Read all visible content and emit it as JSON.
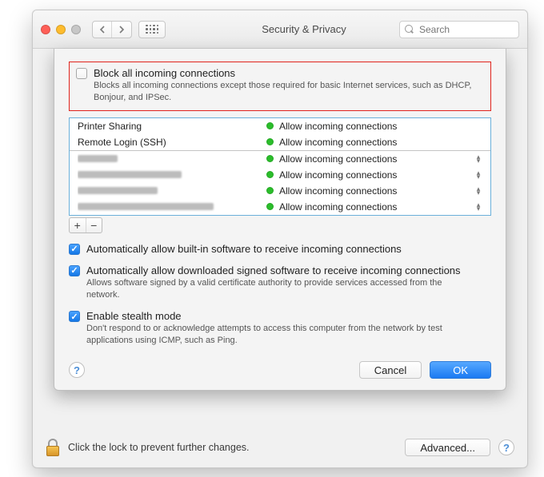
{
  "window": {
    "title": "Security & Privacy",
    "search_placeholder": "Search"
  },
  "sheet": {
    "block_all": {
      "checked": false,
      "label": "Block all incoming connections",
      "desc": "Blocks all incoming connections except those required for basic Internet services, such as DHCP, Bonjour, and IPSec."
    },
    "list": {
      "system": [
        {
          "name": "Printer Sharing",
          "status": "Allow incoming connections"
        },
        {
          "name": "Remote Login (SSH)",
          "status": "Allow incoming connections"
        }
      ],
      "apps": [
        {
          "status": "Allow incoming connections"
        },
        {
          "status": "Allow incoming connections"
        },
        {
          "status": "Allow incoming connections"
        },
        {
          "status": "Allow incoming connections"
        }
      ],
      "add_label": "+",
      "remove_label": "−"
    },
    "auto_builtin": {
      "checked": true,
      "label": "Automatically allow built-in software to receive incoming connections"
    },
    "auto_signed": {
      "checked": true,
      "label": "Automatically allow downloaded signed software to receive incoming connections",
      "desc": "Allows software signed by a valid certificate authority to provide services accessed from the network."
    },
    "stealth": {
      "checked": true,
      "label": "Enable stealth mode",
      "desc": "Don't respond to or acknowledge attempts to access this computer from the network by test applications using ICMP, such as Ping."
    },
    "help_label": "?",
    "cancel_label": "Cancel",
    "ok_label": "OK"
  },
  "bottom": {
    "lock_text": "Click the lock to prevent further changes.",
    "advanced_label": "Advanced...",
    "help_label": "?"
  }
}
